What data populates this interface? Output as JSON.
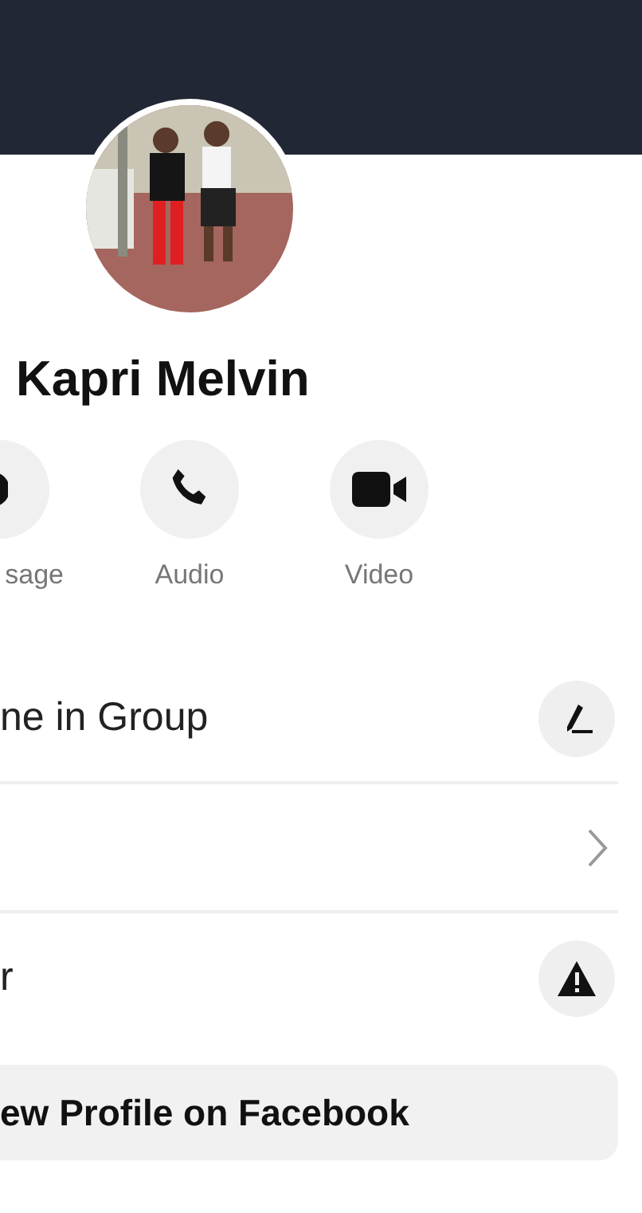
{
  "profile": {
    "name": "Kapri Melvin"
  },
  "actions": [
    {
      "kind": "message",
      "label": "sage"
    },
    {
      "kind": "audio",
      "label": "Audio"
    },
    {
      "kind": "video",
      "label": "Video"
    }
  ],
  "rows": [
    {
      "kind": "edit",
      "label": "ne in Group"
    },
    {
      "kind": "chevron"
    },
    {
      "kind": "warning",
      "label": "r"
    }
  ],
  "button": {
    "label": "ew Profile on Facebook"
  }
}
